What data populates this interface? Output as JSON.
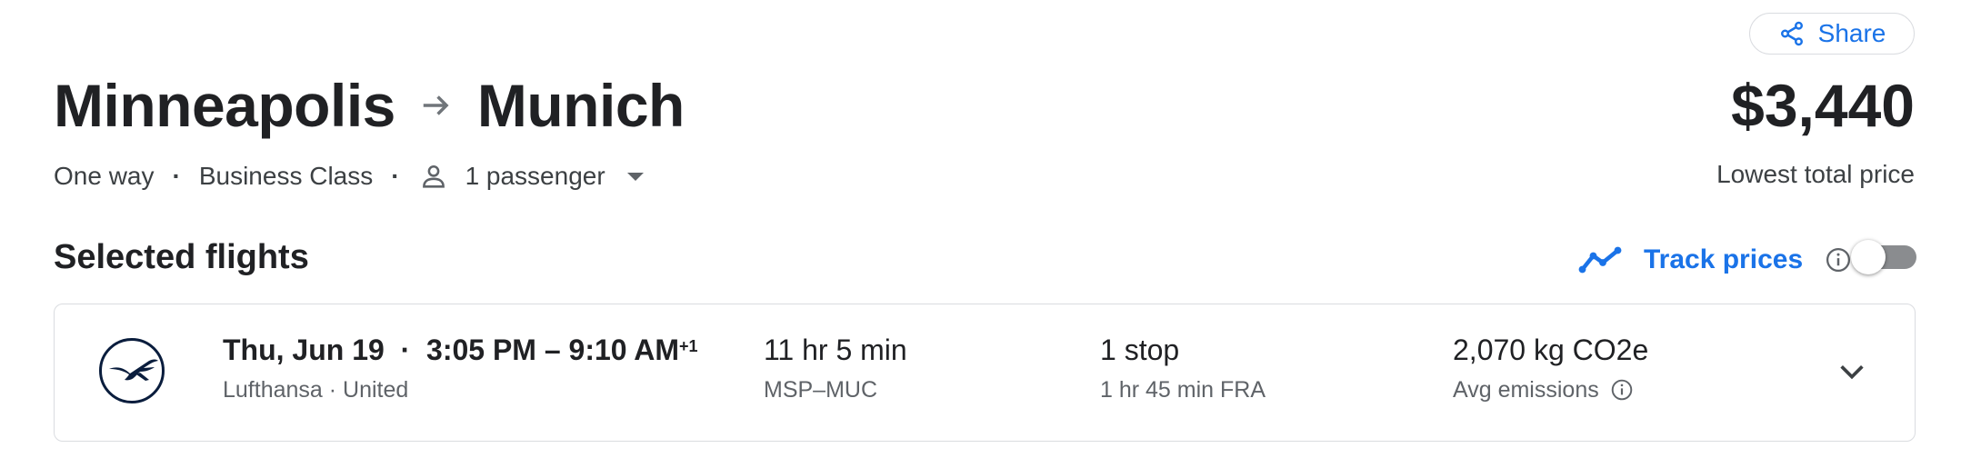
{
  "header": {
    "share_label": "Share",
    "origin": "Minneapolis",
    "destination": "Munich",
    "price": "$3,440",
    "price_caption": "Lowest total price",
    "trip_type": "One way",
    "cabin_class": "Business Class",
    "passengers": "1 passenger"
  },
  "section": {
    "title": "Selected flights",
    "track_prices_label": "Track prices",
    "track_prices_on": false
  },
  "flight": {
    "date": "Thu, Jun 19",
    "times": "3:05 PM – 9:10 AM",
    "day_offset": "+1",
    "airlines": "Lufthansa · United",
    "duration": "11 hr 5 min",
    "route_codes": "MSP–MUC",
    "stops": "1 stop",
    "layover": "1 hr 45 min FRA",
    "emissions": "2,070 kg CO2e",
    "emissions_caption": "Avg emissions"
  },
  "colors": {
    "accent": "#1a73e8",
    "text": "#202124",
    "muted": "#5f6368",
    "border": "#dadce0"
  },
  "icons": [
    "share-icon",
    "arrow-right-icon",
    "person-icon",
    "dropdown-caret-icon",
    "trend-line-icon",
    "info-icon",
    "lufthansa-logo",
    "chevron-down-icon"
  ]
}
